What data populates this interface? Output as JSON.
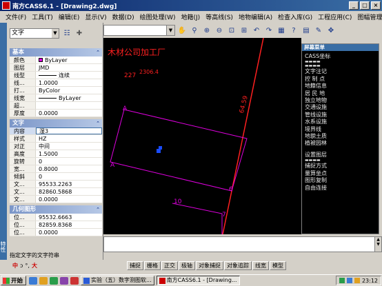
{
  "window": {
    "title": "南方CASS6.1 - [Drawing2.dwg]"
  },
  "menu": [
    "文件(F)",
    "工具(T)",
    "编辑(E)",
    "显示(V)",
    "数据(D)",
    "绘图处理(W)",
    "地籍(J)",
    "等高线(S)",
    "地物编辑(A)",
    "检查入库(G)",
    "工程应用(C)",
    "图幅管理(M)"
  ],
  "colors": {
    "magenta": "#e000e0",
    "red": "#ff2020",
    "blue_square": "#1a4cff",
    "title_blue": "#0a246a"
  },
  "props": {
    "object_type": "文字",
    "handle_label": "特性",
    "sections": [
      {
        "title": "基本",
        "rows": [
          {
            "k": "颜色",
            "v": "ByLayer",
            "swatch": true
          },
          {
            "k": "图层",
            "v": "JMD"
          },
          {
            "k": "线型",
            "v": "连续",
            "line": true
          },
          {
            "k": "线...",
            "v": "1.0000"
          },
          {
            "k": "打...",
            "v": "ByColor"
          },
          {
            "k": "线宽",
            "v": "ByLayer",
            "line": true
          },
          {
            "k": "超...",
            "v": ""
          },
          {
            "k": "厚度",
            "v": "0.0000"
          }
        ]
      },
      {
        "title": "文字",
        "rows": [
          {
            "k": "内容",
            "v": "湿3",
            "selected": true
          },
          {
            "k": "样式",
            "v": "HZ"
          },
          {
            "k": "对正",
            "v": "中间"
          },
          {
            "k": "高度",
            "v": "1.5000"
          },
          {
            "k": "旋转",
            "v": "0"
          },
          {
            "k": "宽...",
            "v": "0.8000"
          },
          {
            "k": "倾斜",
            "v": "0"
          },
          {
            "k": "文...",
            "v": "95533.2263"
          },
          {
            "k": "文...",
            "v": "82860.5868"
          },
          {
            "k": "文...",
            "v": "0.0000"
          }
        ]
      },
      {
        "title": "几何图形",
        "rows": [
          {
            "k": "位...",
            "v": "95532.6663"
          },
          {
            "k": "位...",
            "v": "82859.8368"
          },
          {
            "k": "位...",
            "v": "0.0000"
          }
        ]
      }
    ],
    "hint": "指定文字的文字符串"
  },
  "canvas": {
    "title_text": "木材公司加工厂",
    "labels": {
      "l227": "227",
      "l2306": "2306.4",
      "lA1": "A",
      "lA2": "A",
      "l6": "6",
      "l7": "7",
      "l10": "10",
      "l6459": "64.59"
    }
  },
  "screen_menu": {
    "title": "屏幕菜单",
    "items_top": [
      "CASS坐标"
    ],
    "items_mid": [
      "文字注记",
      "控 制 点",
      "地籍信息",
      "居 民 地",
      "独立地物",
      "交通设施",
      "管线设施",
      "水系设施",
      "境界线",
      "地貌土质",
      "植被园林"
    ],
    "items_bot": [
      "设置图层",
      "捕捉方式",
      "量算坐点",
      "图形复制",
      "自由连接"
    ]
  },
  "status": {
    "ime": [
      "中",
      "ɔ",
      "°,",
      "大"
    ],
    "buttons": [
      "捕捉",
      "栅格",
      "正交",
      "极轴",
      "对象捕捉",
      "对象追踪",
      "线宽",
      "模型"
    ]
  },
  "taskbar": {
    "start": "开始",
    "tasks": [
      "实验（五）数字测图软...",
      "南方CASS6.1 - [Drawing..."
    ],
    "clock": "23:12"
  }
}
